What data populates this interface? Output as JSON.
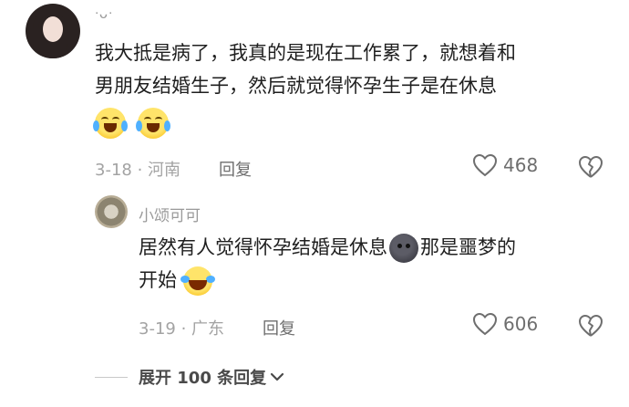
{
  "main_comment": {
    "author": "ᐧᴗᐧ",
    "text_line1": "我大抵是病了，我真的是现在工作累了，就想着和",
    "text_line2": "男朋友结婚生子，然后就觉得怀孕生子是在休息",
    "emojis": [
      "crying-laughing-emoji",
      "crying-laughing-emoji"
    ],
    "date_location": "3-18 · 河南",
    "reply_label": "回复",
    "like_count": "468"
  },
  "reply_comment": {
    "author": "小颂可可",
    "text_part1": "居然有人觉得怀孕结婚是休息",
    "text_part2": "那是噩梦的",
    "text_line2": "开始",
    "date_location": "3-19 · 广东",
    "reply_label": "回复",
    "like_count": "606"
  },
  "expand_replies": {
    "label": "展开 100 条回复"
  },
  "colors": {
    "text": "#1f1f1f",
    "meta": "#a3a3a3",
    "icon": "#6e6e6e"
  }
}
